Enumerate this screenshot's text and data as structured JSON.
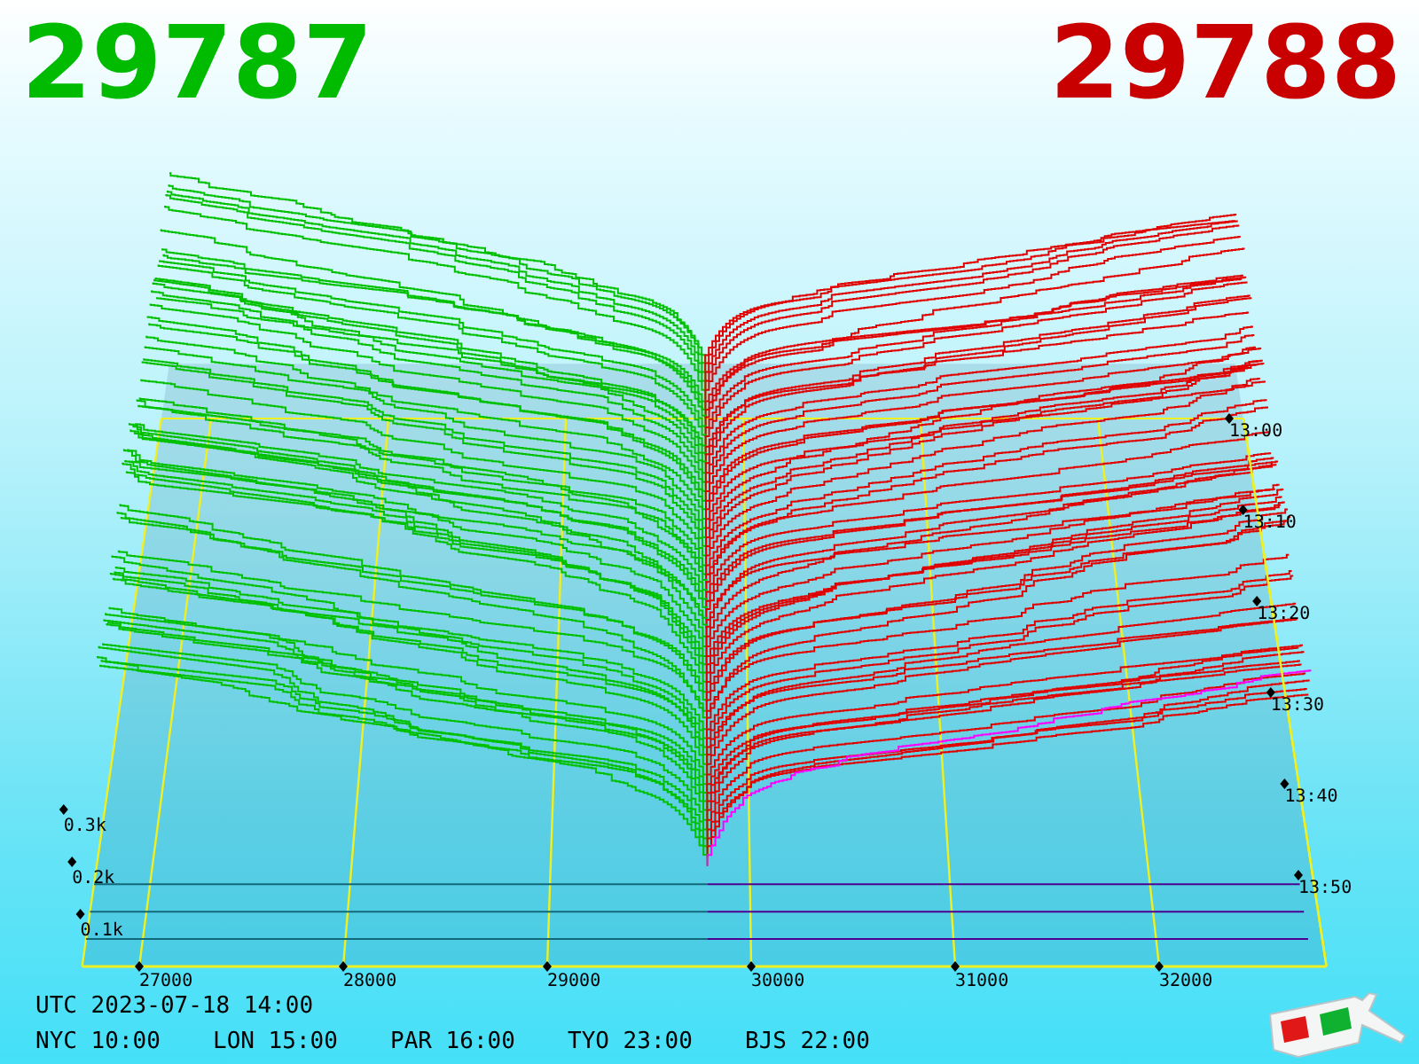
{
  "bid_price": "29787",
  "ask_price": "29788",
  "depth_chart": {
    "price_labels": [
      "27000",
      "28000",
      "29000",
      "30000",
      "31000",
      "32000"
    ],
    "volume_labels": [
      "0.3k",
      "0.2k",
      "0.1k"
    ],
    "time_labels": [
      "13:00",
      "13:10",
      "13:20",
      "13:30",
      "13:40",
      "13:50"
    ]
  },
  "footer": {
    "utc": "UTC 2023-07-18 14:00",
    "city_times": [
      "NYC 10:00",
      "LON 15:00",
      "PAR 16:00",
      "TYO 23:00",
      "BJS 22:00"
    ]
  }
}
